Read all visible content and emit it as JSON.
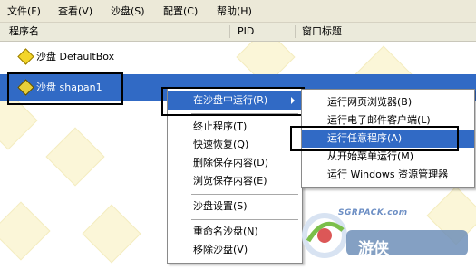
{
  "menubar": {
    "items": [
      "文件(F)",
      "查看(V)",
      "沙盘(S)",
      "配置(C)",
      "帮助(H)"
    ]
  },
  "columns": {
    "name": "程序名",
    "pid": "PID",
    "title": "窗口标题"
  },
  "rows": [
    {
      "label": "沙盘 DefaultBox",
      "selected": false
    },
    {
      "label": "沙盘 shapan1",
      "selected": true
    }
  ],
  "context_menu": {
    "items": [
      {
        "label": "在沙盘中运行(R)",
        "submenu": true,
        "selected": true
      },
      {
        "label": "终止程序(T)"
      },
      {
        "label": "快速恢复(Q)"
      },
      {
        "label": "删除保存内容(D)"
      },
      {
        "label": "浏览保存内容(E)"
      },
      {
        "label": "沙盘设置(S)"
      },
      {
        "label": "重命名沙盘(N)"
      },
      {
        "label": "移除沙盘(V)"
      }
    ]
  },
  "submenu": {
    "items": [
      {
        "label": "运行网页浏览器(B)"
      },
      {
        "label": "运行电子邮件客户端(L)"
      },
      {
        "label": "运行任意程序(A)",
        "selected": true
      },
      {
        "label": "从开始菜单运行(M)"
      },
      {
        "label": "运行 Windows 资源管理器"
      }
    ]
  },
  "watermark": {
    "domain": "SGRPACK.com",
    "brand": "游侠"
  },
  "colors": {
    "selection": "#316ac5",
    "menubar": "#ece9d8",
    "icon": "#f3d52a"
  }
}
